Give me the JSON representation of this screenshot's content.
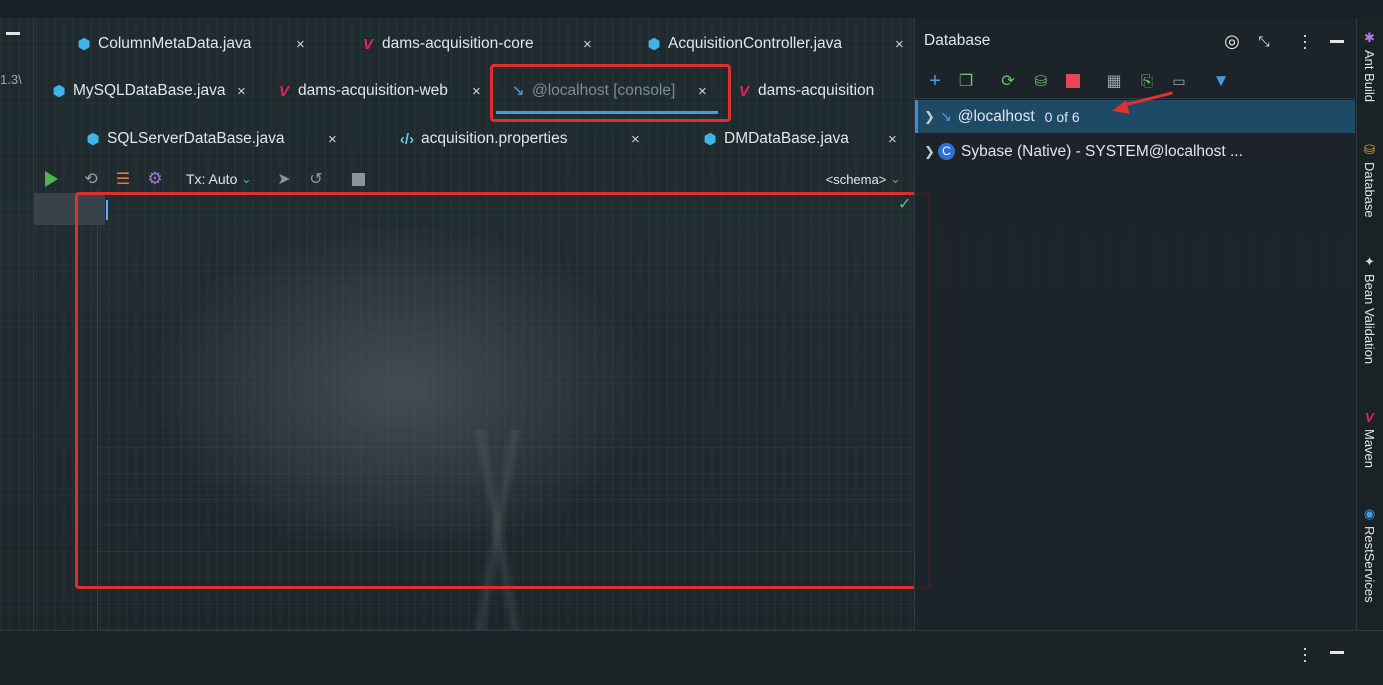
{
  "left_panel": {
    "version_fragment": "1.3\\"
  },
  "tabs": {
    "row1": [
      {
        "label": "ColumnMetaData.java",
        "icon": "java-class-icon"
      },
      {
        "label": "dams-acquisition-core",
        "icon": "maven-icon"
      },
      {
        "label": "AcquisitionController.java",
        "icon": "java-class-icon"
      }
    ],
    "row2": [
      {
        "label": "MySQLDataBase.java",
        "icon": "java-class-icon"
      },
      {
        "label": "dams-acquisition-web",
        "icon": "maven-icon"
      },
      {
        "label": "@localhost [console]",
        "icon": "mysql-dolphin-icon",
        "active": true
      },
      {
        "label": "dams-acquisition",
        "icon": "maven-icon"
      }
    ],
    "row3": [
      {
        "label": "SQLServerDataBase.java",
        "icon": "java-class-icon"
      },
      {
        "label": "acquisition.properties",
        "icon": "properties-icon"
      },
      {
        "label": "DMDataBase.java",
        "icon": "java-class-icon"
      }
    ],
    "close_glyph": "×"
  },
  "editor_toolbar": {
    "tx_mode": "Tx: Auto",
    "schema": "<schema>"
  },
  "database_panel": {
    "title": "Database",
    "tree": [
      {
        "name": "@localhost",
        "count": "0 of 6",
        "selected": true,
        "icon": "mysql-dolphin-icon"
      },
      {
        "name": "Sybase (Native) - SYSTEM@localhost ...",
        "icon": "sybase-icon"
      }
    ]
  },
  "side_tools": [
    {
      "label": "Ant Build",
      "icon": "ant-icon"
    },
    {
      "label": "Database",
      "icon": "database-icon"
    },
    {
      "label": "Bean Validation",
      "icon": "bean-validation-icon"
    },
    {
      "label": "Maven",
      "icon": "maven-icon"
    },
    {
      "label": "RestServices",
      "icon": "rest-services-icon"
    }
  ],
  "colors": {
    "accent_blue": "#4b9edc",
    "highlight_red": "#e02d2d",
    "selection": "#1e4a66",
    "run_green": "#51b24f"
  }
}
